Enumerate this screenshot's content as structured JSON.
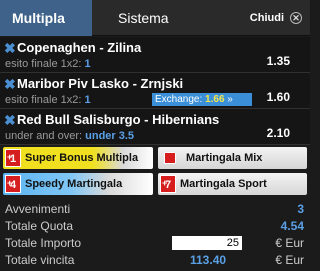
{
  "tabs": {
    "active": "Multipla",
    "inactive": "Sistema",
    "close": "Chiudi"
  },
  "bets": [
    {
      "title": "Copenaghen - Zilina",
      "sub_label": "esito finale 1x2:",
      "sub_value": "1",
      "odds": "1.35"
    },
    {
      "title": "Maribor Piv Lasko - Zrnjski",
      "sub_label": "esito finale 1x2:",
      "sub_value": "1",
      "odds": "1.60",
      "exchange_label": "Exchange:",
      "exchange_value": "1.66",
      "exchange_arrow": "»"
    },
    {
      "title": "Red Bull Salisburgo - Hibernians",
      "sub_label": "under and over:",
      "sub_value": "under 3.5",
      "odds": "2.10"
    }
  ],
  "bonus_buttons": [
    {
      "badge": "1",
      "label": "Super Bonus Multipla"
    },
    {
      "badge": "",
      "label": "Martingala Mix"
    },
    {
      "badge": "4",
      "label": "Speedy Martingala"
    },
    {
      "badge": "7",
      "label": "Martingala Sport"
    }
  ],
  "summary": {
    "avvenimenti_label": "Avvenimenti",
    "avvenimenti_value": "3",
    "quota_label": "Totale Quota",
    "quota_value": "4.54",
    "importo_label": "Totale Importo",
    "importo_value": "25",
    "importo_currency": "€ Eur",
    "vincita_label": "Totale vincita",
    "vincita_value": "113.40",
    "vincita_currency": "€ Eur"
  },
  "colors": {
    "accent": "#3e6289",
    "link": "#5aa0e6",
    "badge": "#d71e1e"
  }
}
